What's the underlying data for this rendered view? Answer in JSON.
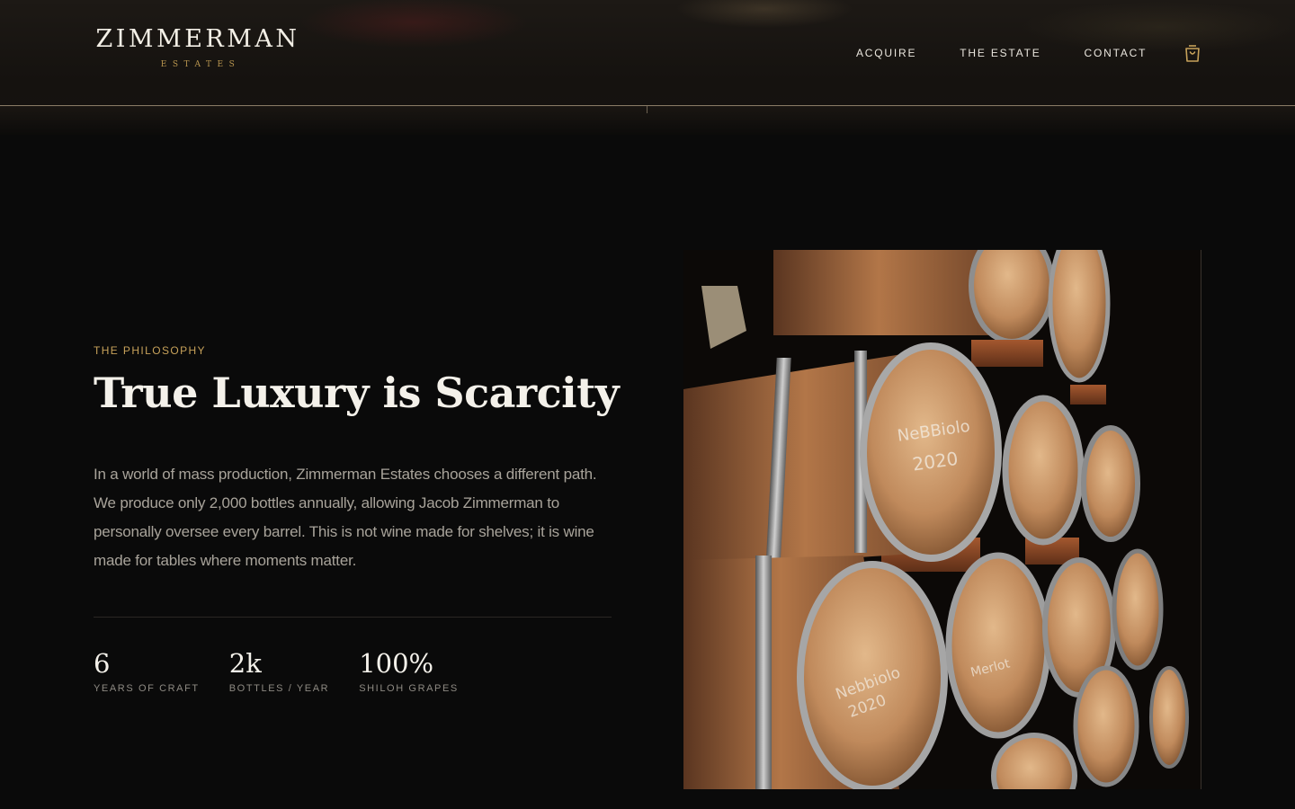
{
  "brand": {
    "name": "ZIMMERMAN",
    "subtitle": "ESTATES"
  },
  "nav": {
    "items": [
      {
        "label": "ACQUIRE"
      },
      {
        "label": "THE ESTATE"
      },
      {
        "label": "CONTACT"
      }
    ],
    "cart_icon": "shopping-bag-icon"
  },
  "philosophy": {
    "eyebrow": "THE PHILOSOPHY",
    "title": "True Luxury is Scarcity",
    "body": "In a world of mass production, Zimmerman Estates chooses a different path. We produce only 2,000 bottles annually, allowing Jacob Zimmerman to personally oversee every barrel. This is not wine made for shelves; it is wine made for tables where moments matter."
  },
  "stats": [
    {
      "value": "6",
      "label": "YEARS OF CRAFT"
    },
    {
      "value": "2k",
      "label": "BOTTLES / YEAR"
    },
    {
      "value": "100%",
      "label": "SHILOH GRAPES"
    }
  ],
  "colors": {
    "background": "#0a0a0a",
    "accent_gold": "#c7a25a",
    "text_primary": "#f4f1ea",
    "text_muted": "#a8a39a"
  }
}
